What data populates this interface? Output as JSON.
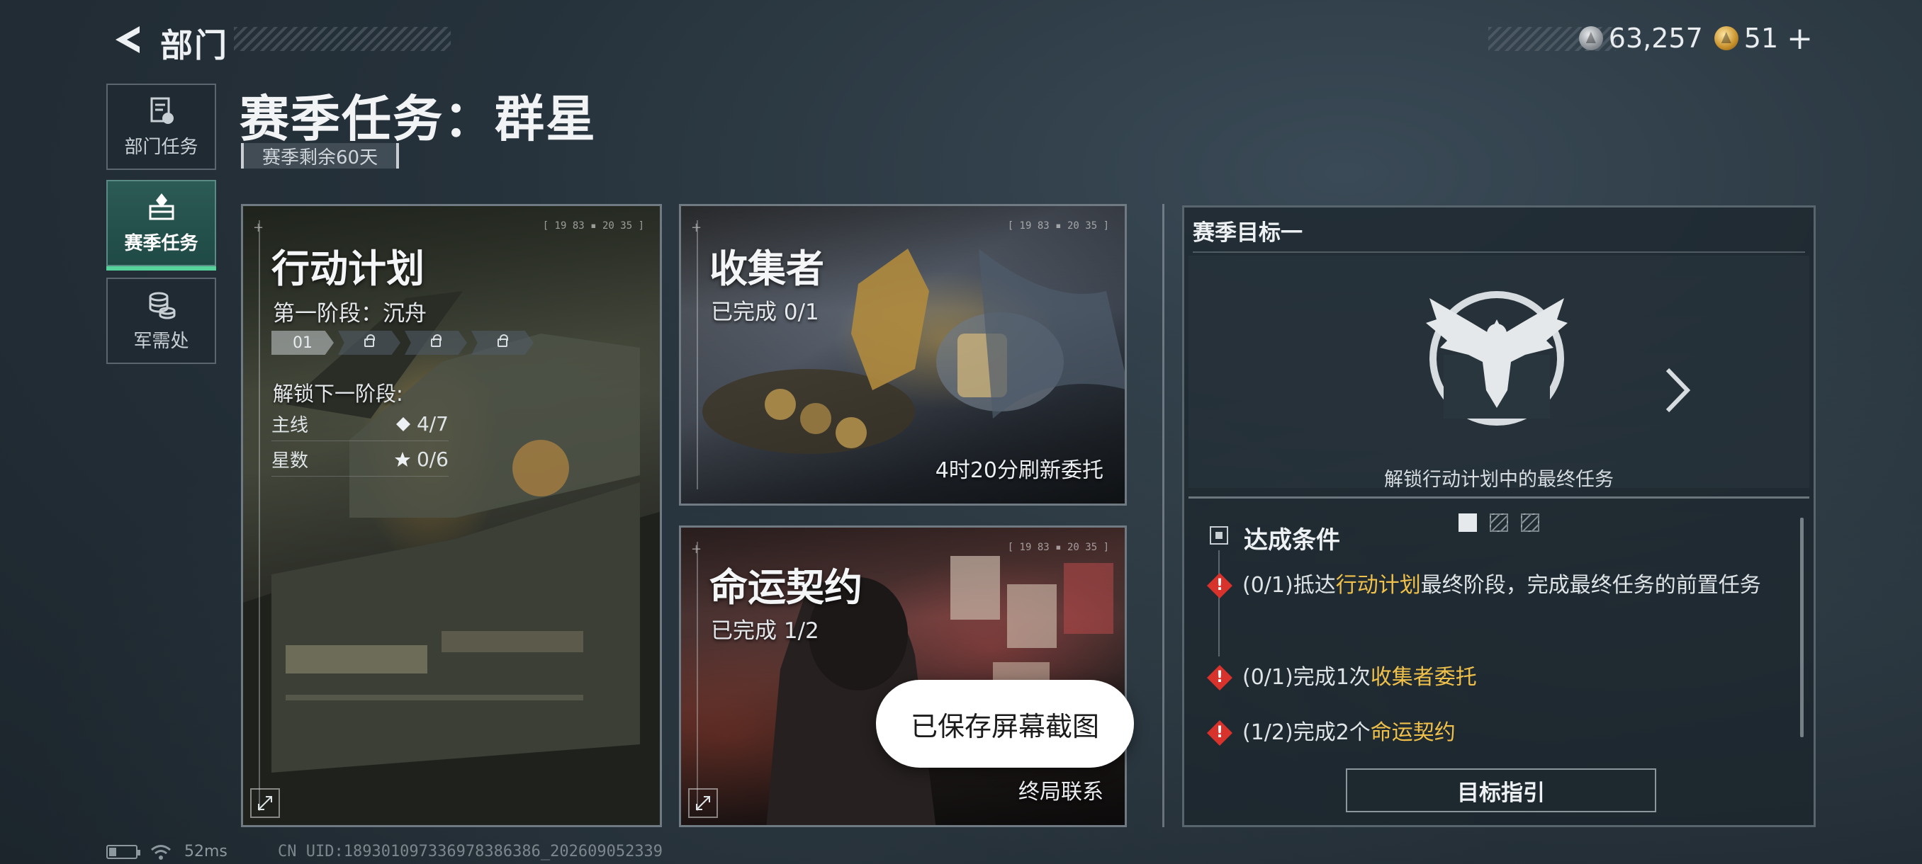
{
  "header": {
    "title": "部门",
    "currencies": [
      {
        "icon": "silver-coin-icon",
        "value": "63,257"
      },
      {
        "icon": "gold-coin-icon",
        "value": "51"
      }
    ],
    "plus_label": "+"
  },
  "nav": {
    "items": [
      {
        "label": "部门任务",
        "icon": "department-task-icon",
        "active": false
      },
      {
        "label": "赛季任务",
        "icon": "season-task-icon",
        "active": true
      },
      {
        "label": "军需处",
        "icon": "quartermaster-icon",
        "active": false
      }
    ]
  },
  "page": {
    "title": "赛季任务：群星",
    "season_remaining": "赛季剩余60天"
  },
  "cards": {
    "plan": {
      "title": "行动计划",
      "stage": "第一阶段：沉舟",
      "stages": [
        "01",
        "",
        "",
        ""
      ],
      "unlock_label": "解锁下一阶段:",
      "requirements": [
        {
          "label": "主线",
          "value": "4/7",
          "icon": "diamond-icon"
        },
        {
          "label": "星数",
          "value": "0/6",
          "icon": "star-icon"
        }
      ],
      "timestamp": "[ 19 83 ▪ 20 35 ]"
    },
    "collector": {
      "title": "收集者",
      "progress": "已完成 0/1",
      "refresh": "4时20分刷新委托",
      "timestamp": "[ 19 83 ▪ 20 35 ]"
    },
    "fate": {
      "title": "命运契约",
      "progress": "已完成 1/2",
      "footer": "终局联系",
      "timestamp": "[ 19 83 ▪ 20 35 ]"
    }
  },
  "goal": {
    "header": "赛季目标一",
    "description": "解锁行动计划中的最终任务",
    "page_index": 1,
    "page_count": 3,
    "conditions_title": "达成条件",
    "conditions": [
      {
        "prefix": "(0/1)抵达",
        "highlight": "行动计划",
        "suffix": "最终阶段，完成最终任务的前置任务"
      },
      {
        "prefix": "(0/1)完成1次",
        "highlight": "收集者委托",
        "suffix": ""
      },
      {
        "prefix": "(1/2)完成2个",
        "highlight": "命运契约",
        "suffix": ""
      }
    ],
    "guide_button": "目标指引"
  },
  "toast": "已保存屏幕截图",
  "status": {
    "latency": "52ms",
    "uid": "CN UID:18930109733697838638​6_202609052339"
  },
  "colors": {
    "accent_green": "#56d39b",
    "highlight_gold": "#f0c14a",
    "warning_red": "#d7322b"
  }
}
